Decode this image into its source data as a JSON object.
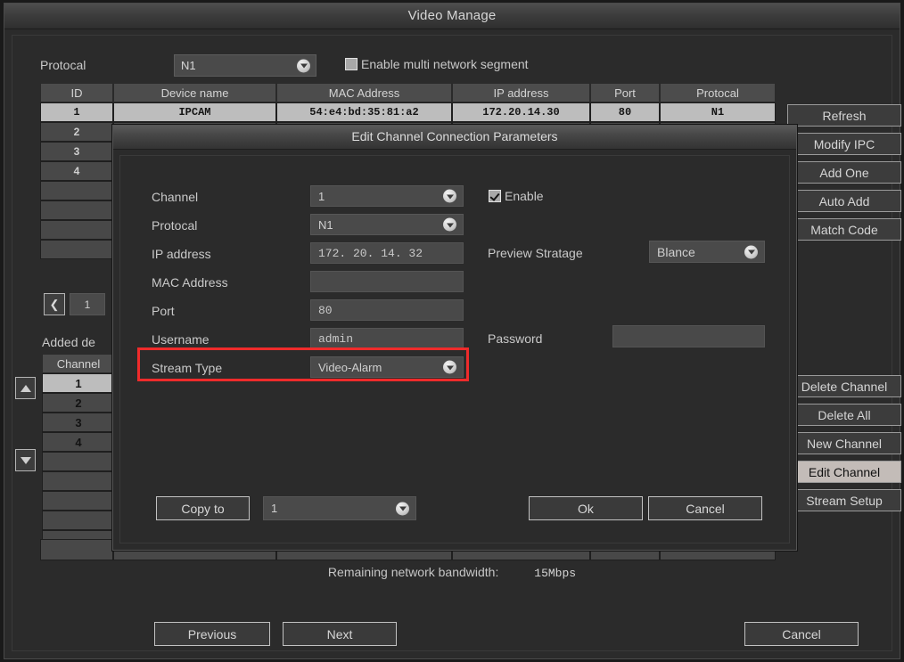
{
  "window": {
    "title": "Video Manage"
  },
  "toolbar": {
    "protocol_label": "Protocal",
    "protocol_value": "N1",
    "multi_segment_label": "Enable multi network segment",
    "multi_segment_checked": false
  },
  "device_table": {
    "headers": [
      "ID",
      "Device name",
      "MAC Address",
      "IP address",
      "Port",
      "Protocal"
    ],
    "rows": [
      {
        "id": "1",
        "device_name": "IPCAM",
        "mac": "54:e4:bd:35:81:a2",
        "ip": "172.20.14.30",
        "port": "80",
        "protocol": "N1"
      },
      {
        "id": "2",
        "device_name": "",
        "mac": "",
        "ip": "",
        "port": "",
        "protocol": ""
      },
      {
        "id": "3",
        "device_name": "",
        "mac": "",
        "ip": "",
        "port": "",
        "protocol": ""
      },
      {
        "id": "4",
        "device_name": "",
        "mac": "",
        "ip": "",
        "port": "",
        "protocol": ""
      },
      {
        "id": "",
        "device_name": "",
        "mac": "",
        "ip": "",
        "port": "",
        "protocol": ""
      },
      {
        "id": "",
        "device_name": "",
        "mac": "",
        "ip": "",
        "port": "",
        "protocol": ""
      },
      {
        "id": "",
        "device_name": "",
        "mac": "",
        "ip": "",
        "port": "",
        "protocol": ""
      },
      {
        "id": "",
        "device_name": "",
        "mac": "",
        "ip": "",
        "port": "",
        "protocol": ""
      }
    ]
  },
  "pager": {
    "prev_icon": "chevron-left-icon",
    "page": "1"
  },
  "added_devices": {
    "section_label": "Added de",
    "column_header": "Channel",
    "rows": [
      "1",
      "2",
      "3",
      "4",
      "",
      "",
      "",
      "",
      ""
    ],
    "selected_index": 0,
    "scroll_up_icon": "triangle-up-icon",
    "scroll_down_icon": "triangle-down-icon"
  },
  "right_buttons_top": [
    {
      "label": "Refresh",
      "active": false
    },
    {
      "label": "Modify IPC",
      "active": false
    },
    {
      "label": "Add One",
      "active": false
    },
    {
      "label": "Auto Add",
      "active": false
    },
    {
      "label": "Match Code",
      "active": false
    }
  ],
  "right_buttons_bottom": [
    {
      "label": "Delete Channel",
      "active": false
    },
    {
      "label": "Delete All",
      "active": false
    },
    {
      "label": "New Channel",
      "active": false
    },
    {
      "label": "Edit Channel",
      "active": true
    },
    {
      "label": "Stream Setup",
      "active": false
    }
  ],
  "status": {
    "bandwidth_label": "Remaining network bandwidth:",
    "bandwidth_value": "15Mbps"
  },
  "footer": {
    "previous_label": "Previous",
    "next_label": "Next",
    "cancel_label": "Cancel"
  },
  "dialog": {
    "title": "Edit Channel Connection Parameters",
    "fields": {
      "channel_label": "Channel",
      "channel_value": "1",
      "protocol_label": "Protocal",
      "protocol_value": "N1",
      "ip_label": "IP address",
      "ip_value": "172. 20. 14. 32",
      "mac_label": "MAC Address",
      "mac_value": "",
      "port_label": "Port",
      "port_value": "80",
      "username_label": "Username",
      "username_value": "admin",
      "stream_type_label": "Stream Type",
      "stream_type_value": "Video-Alarm",
      "enable_label": "Enable",
      "enable_checked": true,
      "preview_strategy_label": "Preview Stratage",
      "preview_strategy_value": "Blance",
      "password_label": "Password",
      "password_value": ""
    },
    "buttons": {
      "copy_to_label": "Copy to",
      "copy_to_value": "1",
      "ok_label": "Ok",
      "cancel_label": "Cancel"
    },
    "highlight_color": "#ef2b2b"
  }
}
